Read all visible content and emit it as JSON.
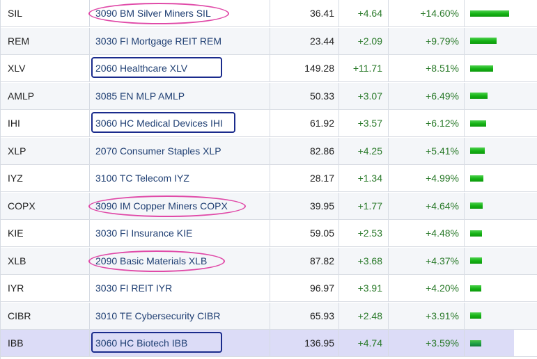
{
  "bar_max_pct": 14.6,
  "colors": {
    "ellipse_mark": "#e04aa8",
    "box_mark": "#1a2b8c",
    "positive": "#2a7a2a",
    "bar": "#14b114",
    "highlight_row": "#dcdcf7"
  },
  "rows": [
    {
      "symbol": "SIL",
      "name": "3090 BM Silver Miners SIL",
      "last": "36.41",
      "change": "+4.64",
      "pct_change": "+14.60%",
      "pct_value": 14.6,
      "mark": "ellipse"
    },
    {
      "symbol": "REM",
      "name": "3030 FI Mortgage REIT REM",
      "last": "23.44",
      "change": "+2.09",
      "pct_change": "+9.79%",
      "pct_value": 9.79,
      "mark": "none"
    },
    {
      "symbol": "XLV",
      "name": "2060 Healthcare XLV",
      "last": "149.28",
      "change": "+11.71",
      "pct_change": "+8.51%",
      "pct_value": 8.51,
      "mark": "box"
    },
    {
      "symbol": "AMLP",
      "name": "3085 EN MLP AMLP",
      "last": "50.33",
      "change": "+3.07",
      "pct_change": "+6.49%",
      "pct_value": 6.49,
      "mark": "none"
    },
    {
      "symbol": "IHI",
      "name": "3060 HC Medical Devices IHI",
      "last": "61.92",
      "change": "+3.57",
      "pct_change": "+6.12%",
      "pct_value": 6.12,
      "mark": "box"
    },
    {
      "symbol": "XLP",
      "name": "2070 Consumer Staples XLP",
      "last": "82.86",
      "change": "+4.25",
      "pct_change": "+5.41%",
      "pct_value": 5.41,
      "mark": "none"
    },
    {
      "symbol": "IYZ",
      "name": "3100 TC Telecom IYZ",
      "last": "28.17",
      "change": "+1.34",
      "pct_change": "+4.99%",
      "pct_value": 4.99,
      "mark": "none"
    },
    {
      "symbol": "COPX",
      "name": "3090 IM Copper Miners COPX",
      "last": "39.95",
      "change": "+1.77",
      "pct_change": "+4.64%",
      "pct_value": 4.64,
      "mark": "ellipse"
    },
    {
      "symbol": "KIE",
      "name": "3030 FI Insurance KIE",
      "last": "59.05",
      "change": "+2.53",
      "pct_change": "+4.48%",
      "pct_value": 4.48,
      "mark": "none"
    },
    {
      "symbol": "XLB",
      "name": "2090 Basic Materials XLB",
      "last": "87.82",
      "change": "+3.68",
      "pct_change": "+4.37%",
      "pct_value": 4.37,
      "mark": "ellipse"
    },
    {
      "symbol": "IYR",
      "name": "3030 FI REIT IYR",
      "last": "96.97",
      "change": "+3.91",
      "pct_change": "+4.20%",
      "pct_value": 4.2,
      "mark": "none"
    },
    {
      "symbol": "CIBR",
      "name": "3010 TE Cybersecurity CIBR",
      "last": "65.93",
      "change": "+2.48",
      "pct_change": "+3.91%",
      "pct_value": 3.91,
      "mark": "none"
    },
    {
      "symbol": "IBB",
      "name": "3060 HC Biotech IBB",
      "last": "136.95",
      "change": "+4.74",
      "pct_change": "+3.59%",
      "pct_value": 3.59,
      "mark": "box",
      "highlighted": true
    }
  ]
}
